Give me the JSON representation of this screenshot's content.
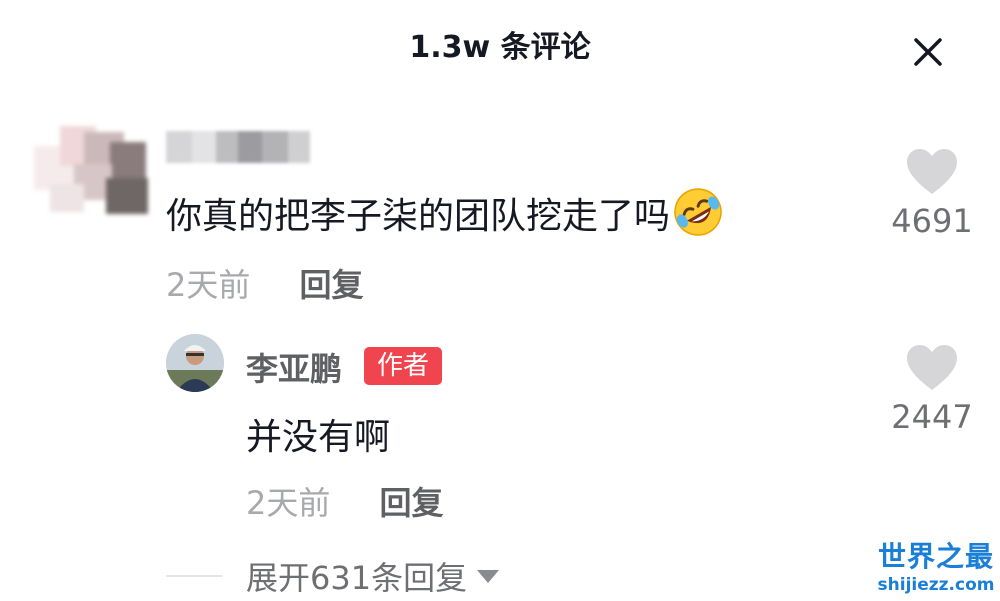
{
  "header": {
    "title": "1.3w 条评论"
  },
  "comment": {
    "text": "你真的把李子柒的团队挖走了吗",
    "emoji": "rofl-emoji",
    "time": "2天前",
    "reply_label": "回复",
    "like_count": "4691"
  },
  "reply": {
    "author_name": "李亚鹏",
    "author_badge": "作者",
    "text": "并没有啊",
    "time": "2天前",
    "reply_label": "回复",
    "like_count": "2447"
  },
  "expand": {
    "label": "展开631条回复"
  },
  "watermark": {
    "title": "世界之最",
    "url": "shijiezz.com"
  },
  "colors": {
    "badge": "#f0454f",
    "like_icon": "#d6d6d8",
    "watermark": "#1a7fd6"
  },
  "icons": [
    "close-icon",
    "heart-icon",
    "caret-down-icon"
  ]
}
